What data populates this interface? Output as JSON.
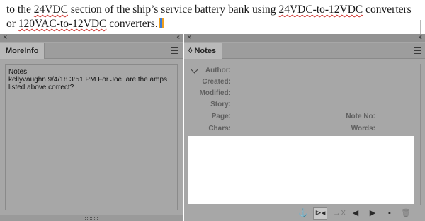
{
  "document": {
    "line1": {
      "a": "to the ",
      "b": "24VDC",
      "c": " section of the ship’s service battery bank using ",
      "d": "24VDC-to-12VDC",
      "e": " converters"
    },
    "line2": {
      "a": "or ",
      "b": "120VAC-to-12VDC",
      "c": " converters."
    }
  },
  "left_panel": {
    "close": "×",
    "collapse": "‹‹",
    "tab_label": "MoreInfo",
    "lines": [
      "Notes:",
      "kellyvaughn 9/4/18 3:51 PM For Joe: are the amps",
      "listed above correct?"
    ]
  },
  "right_panel": {
    "close": "×",
    "collapse": "‹‹",
    "tab_label": "◊ Notes",
    "fields": {
      "author": "Author:",
      "created": "Created:",
      "modified": "Modified:",
      "story": "Story:",
      "page": "Page:",
      "chars": "Chars:",
      "note_no": "Note No:",
      "words": "Words:"
    },
    "toolbar": {
      "anchor": "⚓",
      "prev_next": "⊳◂",
      "convert": "→X",
      "prev": "◀",
      "next": "▶",
      "new_note": "▪",
      "delete": "🗑"
    }
  },
  "colors": {
    "panel_bg": "#a7a7a7",
    "spelling_underline": "#d0312d",
    "notes_area": "#ffffff"
  }
}
